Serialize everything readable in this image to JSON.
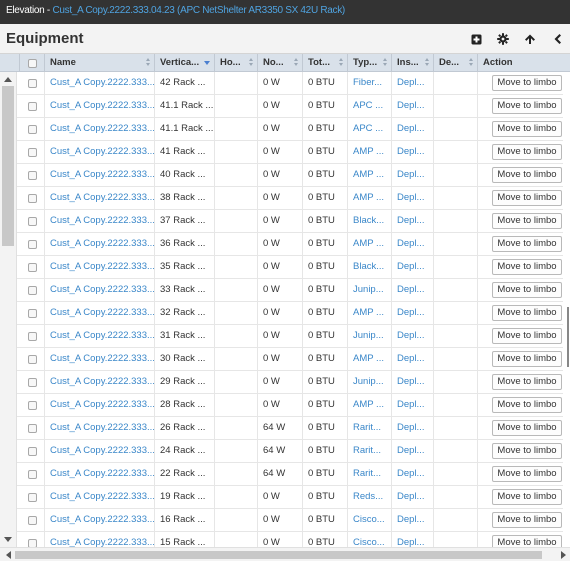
{
  "window": {
    "title_prefix": "Elevation",
    "title_sep": " - ",
    "title_link": "Cust_A Copy.2222.333.04.23 (APC NetShelter AR3350 SX 42U Rack)"
  },
  "panel": {
    "title": "Equipment",
    "icons": [
      "add-icon",
      "gear-icon",
      "arrow-up-icon",
      "chevron-left-icon"
    ]
  },
  "table": {
    "columns": [
      "Name",
      "Vertica...",
      "Ho...",
      "No...",
      "Tot...",
      "Typ...",
      "Ins...",
      "De...",
      "Action"
    ],
    "rows": [
      {
        "name": "Cust_A Copy.2222.333....",
        "vert": "42 Rack ...",
        "ho": "",
        "no": "0 W",
        "tot": "0 BTU",
        "typ": "Fiber...",
        "ins": "Depl...",
        "de": "",
        "action": "Move to limbo"
      },
      {
        "name": "Cust_A Copy.2222.333....",
        "vert": "41.1 Rack ...",
        "ho": "",
        "no": "0 W",
        "tot": "0 BTU",
        "typ": "APC ...",
        "ins": "Depl...",
        "de": "",
        "action": "Move to limbo"
      },
      {
        "name": "Cust_A Copy.2222.333....",
        "vert": "41.1 Rack ...",
        "ho": "",
        "no": "0 W",
        "tot": "0 BTU",
        "typ": "APC ...",
        "ins": "Depl...",
        "de": "",
        "action": "Move to limbo"
      },
      {
        "name": "Cust_A Copy.2222.333....",
        "vert": "41 Rack ...",
        "ho": "",
        "no": "0 W",
        "tot": "0 BTU",
        "typ": "AMP ...",
        "ins": "Depl...",
        "de": "",
        "action": "Move to limbo"
      },
      {
        "name": "Cust_A Copy.2222.333....",
        "vert": "40 Rack ...",
        "ho": "",
        "no": "0 W",
        "tot": "0 BTU",
        "typ": "AMP ...",
        "ins": "Depl...",
        "de": "",
        "action": "Move to limbo"
      },
      {
        "name": "Cust_A Copy.2222.333....",
        "vert": "38 Rack ...",
        "ho": "",
        "no": "0 W",
        "tot": "0 BTU",
        "typ": "AMP ...",
        "ins": "Depl...",
        "de": "",
        "action": "Move to limbo"
      },
      {
        "name": "Cust_A Copy.2222.333....",
        "vert": "37 Rack ...",
        "ho": "",
        "no": "0 W",
        "tot": "0 BTU",
        "typ": "Black...",
        "ins": "Depl...",
        "de": "",
        "action": "Move to limbo"
      },
      {
        "name": "Cust_A Copy.2222.333....",
        "vert": "36 Rack ...",
        "ho": "",
        "no": "0 W",
        "tot": "0 BTU",
        "typ": "AMP ...",
        "ins": "Depl...",
        "de": "",
        "action": "Move to limbo"
      },
      {
        "name": "Cust_A Copy.2222.333....",
        "vert": "35 Rack ...",
        "ho": "",
        "no": "0 W",
        "tot": "0 BTU",
        "typ": "Black...",
        "ins": "Depl...",
        "de": "",
        "action": "Move to limbo"
      },
      {
        "name": "Cust_A Copy.2222.333....",
        "vert": "33 Rack ...",
        "ho": "",
        "no": "0 W",
        "tot": "0 BTU",
        "typ": "Junip...",
        "ins": "Depl...",
        "de": "",
        "action": "Move to limbo"
      },
      {
        "name": "Cust_A Copy.2222.333....",
        "vert": "32 Rack ...",
        "ho": "",
        "no": "0 W",
        "tot": "0 BTU",
        "typ": "AMP ...",
        "ins": "Depl...",
        "de": "",
        "action": "Move to limbo"
      },
      {
        "name": "Cust_A Copy.2222.333....",
        "vert": "31 Rack ...",
        "ho": "",
        "no": "0 W",
        "tot": "0 BTU",
        "typ": "Junip...",
        "ins": "Depl...",
        "de": "",
        "action": "Move to limbo"
      },
      {
        "name": "Cust_A Copy.2222.333....",
        "vert": "30 Rack ...",
        "ho": "",
        "no": "0 W",
        "tot": "0 BTU",
        "typ": "AMP ...",
        "ins": "Depl...",
        "de": "",
        "action": "Move to limbo"
      },
      {
        "name": "Cust_A Copy.2222.333....",
        "vert": "29 Rack ...",
        "ho": "",
        "no": "0 W",
        "tot": "0 BTU",
        "typ": "Junip...",
        "ins": "Depl...",
        "de": "",
        "action": "Move to limbo"
      },
      {
        "name": "Cust_A Copy.2222.333....",
        "vert": "28 Rack ...",
        "ho": "",
        "no": "0 W",
        "tot": "0 BTU",
        "typ": "AMP ...",
        "ins": "Depl...",
        "de": "",
        "action": "Move to limbo"
      },
      {
        "name": "Cust_A Copy.2222.333....",
        "vert": "26 Rack ...",
        "ho": "",
        "no": "64 W",
        "tot": "0 BTU",
        "typ": "Rarit...",
        "ins": "Depl...",
        "de": "",
        "action": "Move to limbo"
      },
      {
        "name": "Cust_A Copy.2222.333....",
        "vert": "24 Rack ...",
        "ho": "",
        "no": "64 W",
        "tot": "0 BTU",
        "typ": "Rarit...",
        "ins": "Depl...",
        "de": "",
        "action": "Move to limbo"
      },
      {
        "name": "Cust_A Copy.2222.333....",
        "vert": "22 Rack ...",
        "ho": "",
        "no": "64 W",
        "tot": "0 BTU",
        "typ": "Rarit...",
        "ins": "Depl...",
        "de": "",
        "action": "Move to limbo"
      },
      {
        "name": "Cust_A Copy.2222.333....",
        "vert": "19 Rack ...",
        "ho": "",
        "no": "0 W",
        "tot": "0 BTU",
        "typ": "Reds...",
        "ins": "Depl...",
        "de": "",
        "action": "Move to limbo"
      },
      {
        "name": "Cust_A Copy.2222.333....",
        "vert": "16 Rack ...",
        "ho": "",
        "no": "0 W",
        "tot": "0 BTU",
        "typ": "Cisco...",
        "ins": "Depl...",
        "de": "",
        "action": "Move to limbo"
      },
      {
        "name": "Cust_A Copy.2222.333....",
        "vert": "15 Rack ...",
        "ho": "",
        "no": "0 W",
        "tot": "0 BTU",
        "typ": "Cisco...",
        "ins": "Depl...",
        "de": "",
        "action": "Move to limbo"
      }
    ]
  },
  "colors": {
    "titlebar_bg": "#333333",
    "link": "#3a87c9",
    "header_bg": "#d9e1ea",
    "sort_active": "#4a7fd0"
  }
}
